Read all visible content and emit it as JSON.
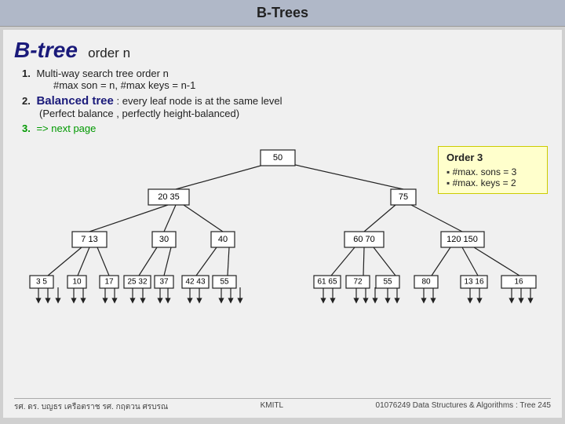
{
  "titleBar": "B-Trees",
  "heading": {
    "btree": "B-tree",
    "subtitle": "order n"
  },
  "listItems": [
    {
      "num": "1.",
      "line1": "Multi-way search tree order n",
      "line2": "#max son = n, #max keys = n-1"
    },
    {
      "num": "2.",
      "balanced": "Balanced tree",
      "rest": " : every leaf node is at the same level",
      "sub": "(Perfect balance , perfectly height-balanced)"
    },
    {
      "num": "3.",
      "text": "=> next page"
    }
  ],
  "orderBox": {
    "title": "Order 3",
    "items": [
      "#max. sons = 3",
      "#max. keys = 2"
    ]
  },
  "tree": {
    "nodes": [
      {
        "id": "root",
        "label": "50"
      },
      {
        "id": "n20_35",
        "label": "20  35"
      },
      {
        "id": "n75",
        "label": "75"
      },
      {
        "id": "n7_13",
        "label": "7  13"
      },
      {
        "id": "n30",
        "label": "30"
      },
      {
        "id": "n40",
        "label": "40"
      },
      {
        "id": "n60_70",
        "label": "60  70"
      },
      {
        "id": "n120_150",
        "label": "120  150"
      },
      {
        "id": "n3_5",
        "label": "3  5"
      },
      {
        "id": "n10",
        "label": "10"
      },
      {
        "id": "n17",
        "label": "17"
      },
      {
        "id": "n25_32",
        "label": "25  32"
      },
      {
        "id": "n37",
        "label": "37"
      },
      {
        "id": "n42_43",
        "label": "42  43"
      },
      {
        "id": "n55",
        "label": "55"
      },
      {
        "id": "n61_65",
        "label": "61  65"
      },
      {
        "id": "n72",
        "label": "72"
      },
      {
        "id": "n80",
        "label": "80"
      },
      {
        "id": "n13_leaf",
        "label": "13  16"
      },
      {
        "id": "n16_leaf",
        "label": "16"
      }
    ]
  },
  "footer": {
    "authors": "รศ. ดร. บญธร    เครือตราช    รศ. กฤตวน    ศรบรณ",
    "institute": "KMITL",
    "course": "01076249 Data Structures & Algorithms : Tree 245"
  }
}
